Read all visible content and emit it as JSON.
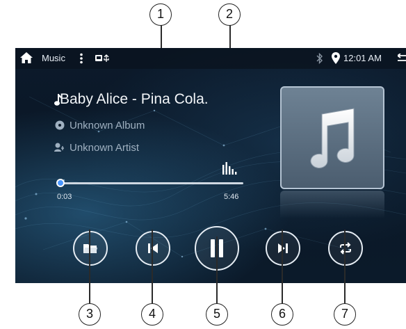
{
  "statusbar": {
    "app_title": "Music",
    "time": "12:01 AM"
  },
  "player": {
    "track_title": "Baby Alice - Pina Cola.",
    "album": "Unknown Album",
    "artist": "Unknown Artist",
    "elapsed": "0:03",
    "duration": "5:46",
    "progress_fraction": 0.01
  },
  "icons": {
    "home": "home-icon",
    "more": "more-vert-icon",
    "usb": "usb-icon",
    "bluetooth": "bluetooth-icon",
    "location": "location-icon",
    "note": "music-note-icon",
    "album": "disc-icon",
    "artist": "artist-icon",
    "eq": "equalizer-icon",
    "folder": "folder-icon",
    "prev": "skip-previous-icon",
    "pause": "pause-icon",
    "next": "skip-next-icon",
    "repeat": "repeat-icon"
  },
  "callouts": [
    "1",
    "2",
    "3",
    "4",
    "5",
    "6",
    "7"
  ],
  "colors": {
    "accent": "#4a97ff",
    "background": "#0c1a2b",
    "text": "#e9eef4"
  }
}
